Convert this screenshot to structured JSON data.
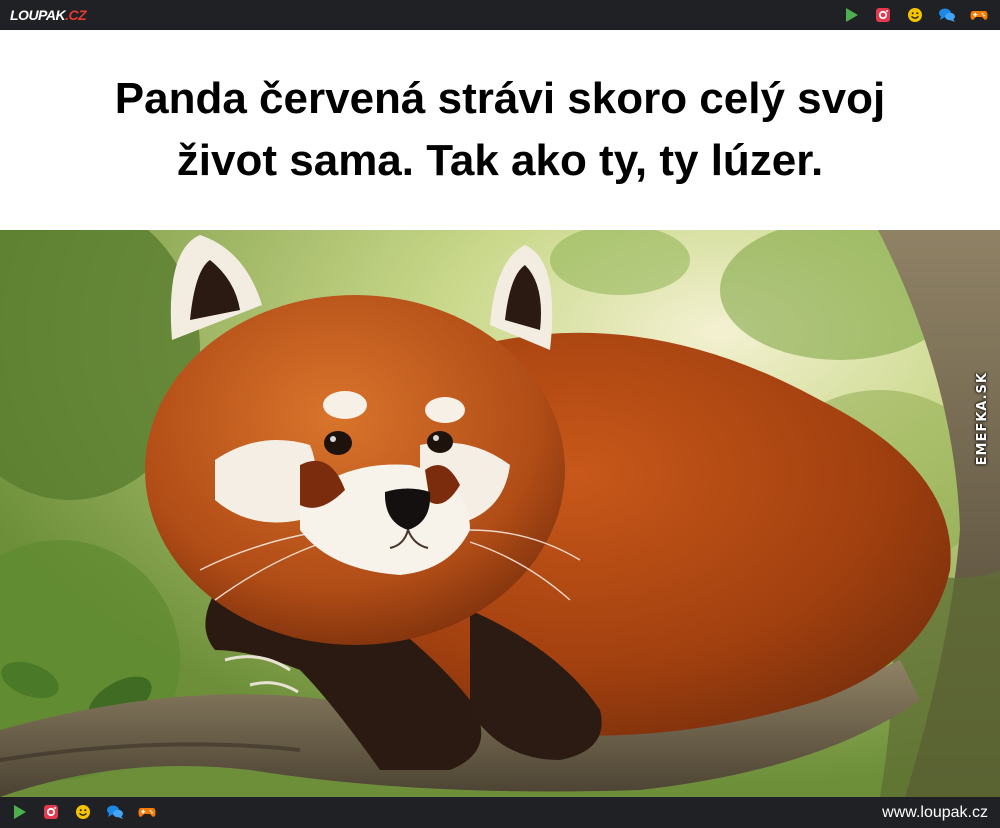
{
  "topbar": {
    "logo": {
      "main": "LOUPAK",
      "suffix": ".CZ"
    },
    "icons": [
      "play-icon",
      "instagram-icon",
      "smiley-icon",
      "chat-icon",
      "gamepad-icon"
    ]
  },
  "post": {
    "caption_line1": "Panda červená strávi skoro celý svoj",
    "caption_line2": "život sama. Tak ako ty, ty lúzer.",
    "watermark": "EMEFKA.SK",
    "image_subject": "red-panda"
  },
  "bottombar": {
    "icons": [
      "play-icon",
      "instagram-icon",
      "smiley-icon",
      "chat-icon",
      "gamepad-icon"
    ],
    "url": "www.loupak.cz"
  },
  "colors": {
    "bar_bg": "#202124",
    "play": "#4caf50",
    "instagram": "#e53950",
    "smiley": "#f5c400",
    "chat": "#1e88e5",
    "gamepad": "#f57c00"
  }
}
